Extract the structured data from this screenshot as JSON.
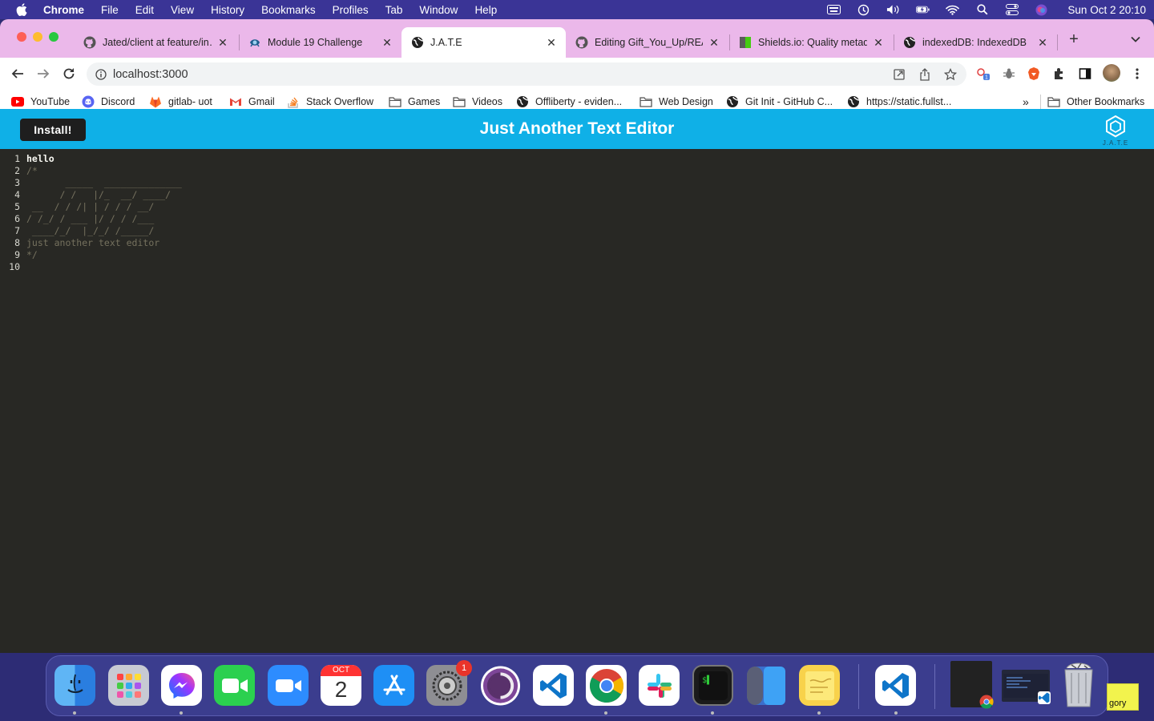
{
  "menubar": {
    "app": "Chrome",
    "items": [
      "File",
      "Edit",
      "View",
      "History",
      "Bookmarks",
      "Profiles",
      "Tab",
      "Window",
      "Help"
    ],
    "clock": "Sun Oct 2  20:10"
  },
  "tabs": [
    {
      "title": "Jated/client at feature/in…",
      "active": false
    },
    {
      "title": "Module 19 Challenge",
      "active": false
    },
    {
      "title": "J.A.T.E",
      "active": true
    },
    {
      "title": "Editing Gift_You_Up/REA…",
      "active": false
    },
    {
      "title": "Shields.io: Quality metad…",
      "active": false
    },
    {
      "title": "indexedDB: IndexedDB",
      "active": false
    }
  ],
  "address": {
    "url": "localhost:3000"
  },
  "bookmarks": [
    {
      "label": "YouTube",
      "icon": "youtube-icon"
    },
    {
      "label": "Discord",
      "icon": "discord-icon"
    },
    {
      "label": "gitlab- uot",
      "icon": "gitlab-icon"
    },
    {
      "label": "Gmail",
      "icon": "gmail-icon"
    },
    {
      "label": "Stack Overflow",
      "icon": "stackoverflow-icon"
    },
    {
      "label": "Games",
      "icon": "folder-icon"
    },
    {
      "label": "Videos",
      "icon": "folder-icon"
    },
    {
      "label": "Offliberty - eviden...",
      "icon": "globe-icon"
    },
    {
      "label": "Web Design",
      "icon": "folder-icon"
    },
    {
      "label": "Git Init - GitHub C...",
      "icon": "globe-icon"
    },
    {
      "label": "https://static.fullst...",
      "icon": "globe-icon"
    }
  ],
  "bookmarks_overflow": "»",
  "other_bookmarks": "Other Bookmarks",
  "app": {
    "install_label": "Install!",
    "title": "Just Another Text Editor",
    "logo_text": "J.A.T.E"
  },
  "editor": {
    "lines": [
      {
        "n": "1",
        "text": "hello",
        "style": "strong"
      },
      {
        "n": "2",
        "text": "/*",
        "style": "comment"
      },
      {
        "n": "3",
        "text": "       _____  ______________",
        "style": "comment"
      },
      {
        "n": "4",
        "text": "      / /   |/_  __/ ____/",
        "style": "comment"
      },
      {
        "n": "5",
        "text": " __  / / /| | / / / __/",
        "style": "comment"
      },
      {
        "n": "6",
        "text": "/ /_/ / ___ |/ / / /___",
        "style": "comment"
      },
      {
        "n": "7",
        "text": " ____/_/  |_/_/ /_____/",
        "style": "comment"
      },
      {
        "n": "8",
        "text": "just another text editor",
        "style": "comment"
      },
      {
        "n": "9",
        "text": "*/",
        "style": "comment"
      },
      {
        "n": "10",
        "text": "",
        "style": "comment"
      }
    ]
  },
  "dock": {
    "apps": [
      "Finder",
      "Launchpad",
      "Messenger",
      "FaceTime",
      "Zoom",
      "Calendar",
      "App Store",
      "System Preferences",
      "Tor Browser",
      "Visual Studio Code",
      "Google Chrome",
      "Slack",
      "Terminal",
      "Sidebar",
      "Stickies",
      "Visual Studio Code"
    ],
    "calendar_month": "OCT",
    "calendar_day": "2",
    "settings_badge": "1",
    "desktop_label": "gory"
  }
}
